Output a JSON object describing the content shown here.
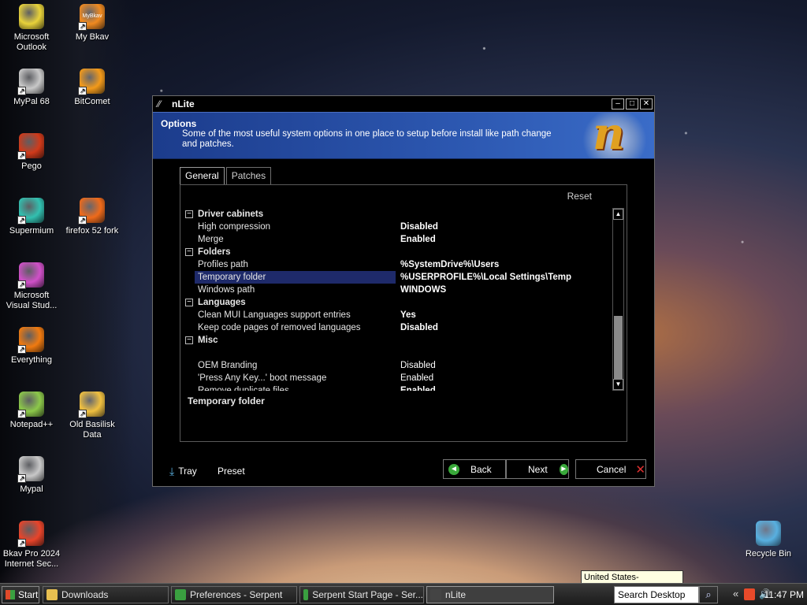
{
  "desktop": {
    "icons": [
      {
        "label": "Microsoft\nOutlook",
        "color": "#e8d23a"
      },
      {
        "label": "My Bkav",
        "color": "#f08a20"
      },
      {
        "label": "MyPal 68",
        "color": "#c8c8c8"
      },
      {
        "label": "BitComet",
        "color": "#f39a1a"
      },
      {
        "label": "Pego",
        "color": "#d03a1a"
      },
      {
        "label": "Supermium",
        "color": "#32c0b0"
      },
      {
        "label": "firefox 52 fork",
        "color": "#ef6a1a"
      },
      {
        "label": "Microsoft\nVisual Stud...",
        "color": "#d050c8"
      },
      {
        "label": "Everything",
        "color": "#f07a10"
      },
      {
        "label": "Notepad++",
        "color": "#8cc84a"
      },
      {
        "label": "Old Basilisk\nData",
        "color": "#f0c040"
      },
      {
        "label": "Mypal",
        "color": "#c8c8c8"
      },
      {
        "label": "Bkav Pro 2024\nInternet Sec...",
        "color": "#e8442a"
      },
      {
        "label": "Recycle Bin",
        "color": "#58b0e0"
      }
    ],
    "my_bkav_badge": "MyBkav"
  },
  "window": {
    "title": "nLite",
    "banner_title": "Options",
    "banner_desc": "Some of the most useful system options in one place to setup before install like path change and patches.",
    "tabs": [
      "General",
      "Patches"
    ],
    "reset": "Reset",
    "groups": [
      {
        "name": "Driver cabinets",
        "items": [
          {
            "name": "High compression",
            "value": "Disabled",
            "bold": true
          },
          {
            "name": "Merge",
            "value": "Enabled",
            "bold": true
          }
        ]
      },
      {
        "name": "Folders",
        "items": [
          {
            "name": "Profiles path",
            "value": "%SystemDrive%\\Users",
            "bold": true
          },
          {
            "name": "Temporary folder",
            "value": "%USERPROFILE%\\Local Settings\\Temp",
            "bold": true,
            "selected": true
          },
          {
            "name": "Windows path",
            "value": "WINDOWS",
            "bold": true
          }
        ]
      },
      {
        "name": "Languages",
        "items": [
          {
            "name": "Clean MUI Languages support entries",
            "value": "Yes",
            "bold": true
          },
          {
            "name": "Keep code pages of removed languages",
            "value": "Disabled",
            "bold": true
          }
        ]
      },
      {
        "name": "Misc",
        "items": [
          {
            "name": "",
            "value": "",
            "bold": false
          },
          {
            "name": "OEM Branding",
            "value": "Disabled",
            "bold": false
          },
          {
            "name": "'Press Any Key...' boot message",
            "value": "Enabled",
            "bold": false
          },
          {
            "name": "Remove duplicate files",
            "value": "Enabled",
            "bold": true
          }
        ]
      }
    ],
    "description_title": "Temporary folder",
    "bottom": {
      "tray": "Tray",
      "preset": "Preset",
      "back": "Back",
      "next": "Next",
      "cancel": "Cancel"
    }
  },
  "taskbar": {
    "start": "Start",
    "tasks": [
      "Downloads",
      "Preferences - Serpent",
      "Serpent Start Page - Ser...",
      "nLite"
    ],
    "search_placeholder": "Search Desktop",
    "tooltip": "United States-International",
    "clock": "11:47 PM",
    "chevron": "«"
  }
}
